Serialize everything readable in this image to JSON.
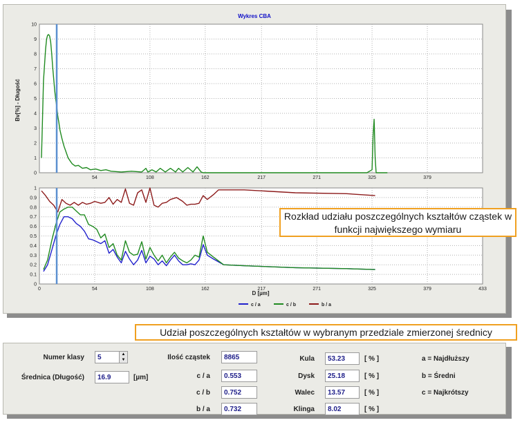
{
  "chart": {
    "title": "Wykres CBA",
    "top_ylabel": "Bv[%] - Długość",
    "xlabel": "D [µm]"
  },
  "callouts": {
    "chart_note": "Rozkład udziału poszczególnych kształtów cząstek w funkcji największego wymiaru",
    "form_note": "Udział poszczególnych kształtów w wybranym przedziale zmierzonej średnicy"
  },
  "form": {
    "class_label": "Numer klasy",
    "class_value": "5",
    "diameter_label": "Średnica (Długość)",
    "diameter_value": "16.9",
    "diameter_unit": "[µm]",
    "count_label": "Ilość cząstek",
    "count_value": "8865",
    "ratios": [
      {
        "label": "c / a",
        "value": "0.553"
      },
      {
        "label": "c / b",
        "value": "0.752"
      },
      {
        "label": "b / a",
        "value": "0.732"
      }
    ],
    "shapes": [
      {
        "label": "Kula",
        "value": "53.23",
        "unit": "[ % ]"
      },
      {
        "label": "Dysk",
        "value": "25.18",
        "unit": "[ % ]"
      },
      {
        "label": "Walec",
        "value": "13.57",
        "unit": "[ % ]"
      },
      {
        "label": "Klinga",
        "value": "8.02",
        "unit": "[ % ]"
      }
    ],
    "legend": [
      "a = Najdłuższy",
      "b = Średni",
      "c = Najkrótszy"
    ]
  },
  "chart_data": [
    {
      "type": "line",
      "title": "Wykres CBA",
      "ylabel": "Bv[%] - Długość",
      "xlabel": "",
      "xlim": [
        0,
        433
      ],
      "ylim": [
        0,
        10
      ],
      "xticks": [
        54,
        108,
        162,
        217,
        271,
        325,
        379
      ],
      "yticks": [
        0,
        1,
        2,
        3,
        4,
        5,
        6,
        7,
        8,
        9,
        10
      ],
      "marker_x": 16.9,
      "series": [
        {
          "color": "#1f8a1f",
          "x": [
            2,
            3,
            4,
            6,
            7,
            8,
            9,
            10,
            11,
            12,
            13,
            14,
            15,
            16,
            17,
            18,
            19,
            20,
            22,
            24,
            26,
            28,
            30,
            32,
            35,
            38,
            42,
            46,
            50,
            55,
            60,
            65,
            70,
            80,
            90,
            100,
            104,
            106,
            110,
            114,
            118,
            123,
            128,
            133,
            136,
            140,
            145,
            150,
            154,
            158,
            160,
            165,
            170,
            175,
            180,
            190,
            200,
            250,
            300,
            320,
            325,
            326,
            327,
            328,
            329,
            330,
            331,
            335,
            340
          ],
          "values": [
            1,
            3.5,
            6.2,
            8.3,
            9,
            9.25,
            9.3,
            9.2,
            8.8,
            8,
            7.1,
            6.3,
            5.5,
            4.9,
            4.4,
            3.8,
            3.4,
            2.9,
            2.3,
            1.8,
            1.4,
            1,
            0.8,
            0.6,
            0.45,
            0.5,
            0.3,
            0.35,
            0.2,
            0.25,
            0.15,
            0.2,
            0.1,
            0.05,
            0.1,
            0.05,
            0.3,
            0.05,
            0.2,
            0.05,
            0.3,
            0.05,
            0.3,
            0.05,
            0.3,
            0.05,
            0.35,
            0.05,
            0.4,
            0.05,
            0,
            0,
            0,
            0,
            0,
            0,
            0,
            0,
            0,
            0,
            0.2,
            2.5,
            3.6,
            1,
            0,
            0,
            0,
            0,
            0
          ]
        }
      ]
    },
    {
      "type": "line",
      "xlabel": "D [µm]",
      "xlim": [
        0,
        433
      ],
      "ylim": [
        0,
        1
      ],
      "xticks": [
        0,
        54,
        108,
        162,
        217,
        271,
        325,
        379,
        433
      ],
      "yticks": [
        0,
        0.1,
        0.2,
        0.3,
        0.4,
        0.5,
        0.6,
        0.7,
        0.8,
        0.9,
        1
      ],
      "marker_x": 16.9,
      "series": [
        {
          "name": "c / a",
          "color": "#2020cc",
          "x": [
            4,
            8,
            12,
            16,
            20,
            24,
            28,
            32,
            36,
            40,
            44,
            48,
            52,
            56,
            60,
            64,
            68,
            72,
            76,
            80,
            84,
            88,
            92,
            96,
            100,
            104,
            108,
            112,
            116,
            120,
            124,
            128,
            132,
            136,
            140,
            144,
            148,
            152,
            156,
            160,
            164,
            170,
            180,
            200,
            250,
            300,
            328
          ],
          "values": [
            0.13,
            0.2,
            0.35,
            0.5,
            0.62,
            0.7,
            0.7,
            0.68,
            0.63,
            0.6,
            0.55,
            0.47,
            0.46,
            0.44,
            0.42,
            0.45,
            0.32,
            0.36,
            0.28,
            0.22,
            0.34,
            0.26,
            0.2,
            0.25,
            0.35,
            0.22,
            0.29,
            0.26,
            0.2,
            0.24,
            0.19,
            0.25,
            0.3,
            0.24,
            0.2,
            0.2,
            0.21,
            0.2,
            0.25,
            0.41,
            0.3,
            0.26,
            0.2,
            0.19,
            0.17,
            0.16,
            0.15
          ]
        },
        {
          "name": "c / b",
          "color": "#1f8a1f",
          "x": [
            4,
            8,
            12,
            16,
            20,
            24,
            28,
            32,
            36,
            40,
            44,
            48,
            52,
            56,
            60,
            64,
            68,
            72,
            76,
            80,
            84,
            88,
            92,
            96,
            100,
            104,
            108,
            112,
            116,
            120,
            124,
            128,
            132,
            136,
            140,
            144,
            148,
            152,
            156,
            160,
            164,
            170,
            180,
            200,
            250,
            300,
            328
          ],
          "values": [
            0.15,
            0.25,
            0.45,
            0.62,
            0.75,
            0.78,
            0.8,
            0.8,
            0.76,
            0.72,
            0.72,
            0.62,
            0.6,
            0.57,
            0.48,
            0.52,
            0.38,
            0.42,
            0.3,
            0.25,
            0.45,
            0.33,
            0.3,
            0.31,
            0.44,
            0.26,
            0.38,
            0.3,
            0.24,
            0.3,
            0.22,
            0.28,
            0.33,
            0.27,
            0.24,
            0.22,
            0.25,
            0.3,
            0.28,
            0.5,
            0.33,
            0.28,
            0.2,
            0.19,
            0.17,
            0.16,
            0.15
          ]
        },
        {
          "name": "b / a",
          "color": "#8c1a1a",
          "x": [
            2,
            6,
            10,
            14,
            18,
            22,
            26,
            30,
            34,
            38,
            42,
            46,
            50,
            54,
            60,
            64,
            68,
            72,
            76,
            80,
            84,
            88,
            92,
            96,
            100,
            104,
            108,
            112,
            116,
            120,
            124,
            128,
            134,
            140,
            144,
            148,
            152,
            156,
            160,
            164,
            170,
            175,
            180,
            200,
            250,
            300,
            328
          ],
          "values": [
            0.97,
            0.92,
            0.86,
            0.82,
            0.75,
            0.88,
            0.84,
            0.82,
            0.85,
            0.82,
            0.85,
            0.83,
            0.84,
            0.86,
            0.84,
            0.85,
            0.9,
            0.83,
            0.88,
            0.85,
            0.99,
            0.84,
            0.82,
            0.95,
            0.98,
            0.85,
            1.0,
            0.82,
            0.8,
            0.84,
            0.85,
            0.88,
            0.9,
            0.86,
            0.82,
            0.83,
            0.83,
            0.84,
            0.92,
            0.88,
            0.93,
            0.98,
            0.98,
            0.98,
            0.95,
            0.94,
            0.92
          ]
        }
      ]
    }
  ]
}
